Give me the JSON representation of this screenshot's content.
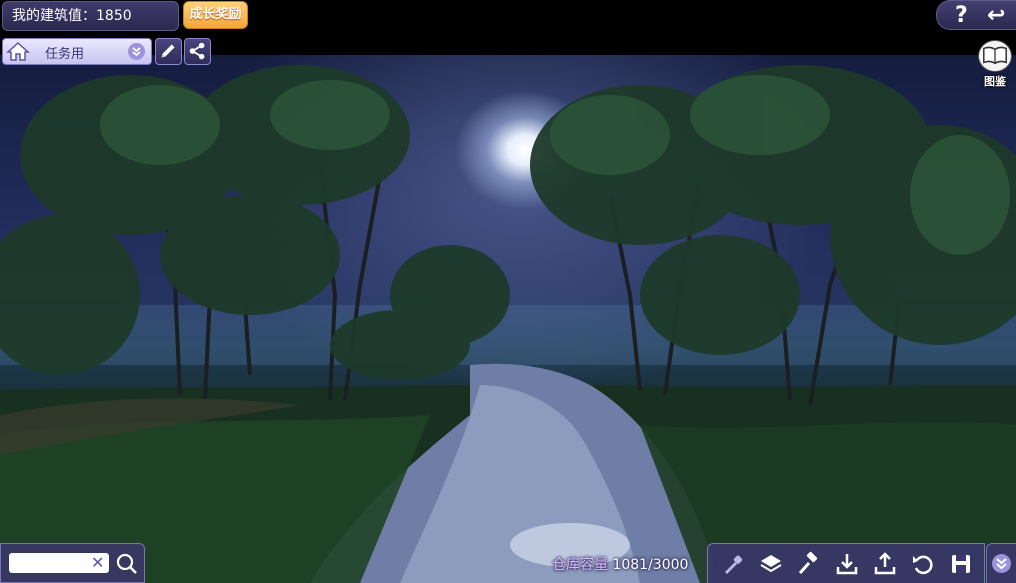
{
  "hud": {
    "building_score": "我的建筑值：1850",
    "reward_label": "成长奖励",
    "help_icon": "?",
    "back_icon": "↩"
  },
  "mode": {
    "label": "任务用"
  },
  "atlas": {
    "label": "图鉴"
  },
  "search": {
    "value": "",
    "placeholder": ""
  },
  "storage": {
    "label": "仓库容量",
    "value": "1081/3000"
  },
  "toolbar_icons": [
    "pipette-icon",
    "layers-icon",
    "hammer-icon",
    "download-icon",
    "upload-icon",
    "undo-icon",
    "save-icon"
  ],
  "colors": {
    "hud_bg": "#2b2850",
    "reward_bg": "#f3a637",
    "mode_bg": "#ece8ff",
    "accent_purple": "#9d93dd"
  }
}
